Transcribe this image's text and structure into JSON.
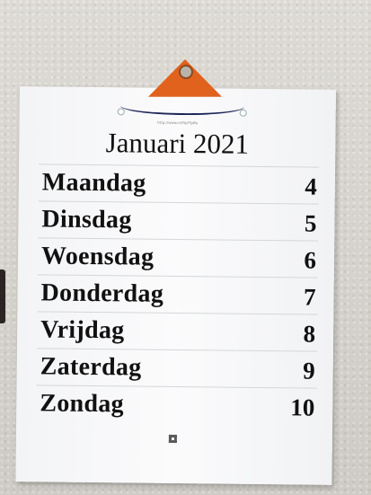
{
  "calendar": {
    "url_text": "http://www.nl/GpfTpBe",
    "title": "Januari 2021",
    "days": [
      {
        "name": "Maandag",
        "date": "4"
      },
      {
        "name": "Dinsdag",
        "date": "5"
      },
      {
        "name": "Woensdag",
        "date": "6"
      },
      {
        "name": "Donderdag",
        "date": "7"
      },
      {
        "name": "Vrijdag",
        "date": "8"
      },
      {
        "name": "Zaterdag",
        "date": "9"
      },
      {
        "name": "Zondag",
        "date": "10"
      }
    ]
  },
  "colors": {
    "hanger": "#e0621d",
    "string": "#1d2557",
    "paper": "#f7f8fa",
    "wall": "#d9d6cf"
  }
}
